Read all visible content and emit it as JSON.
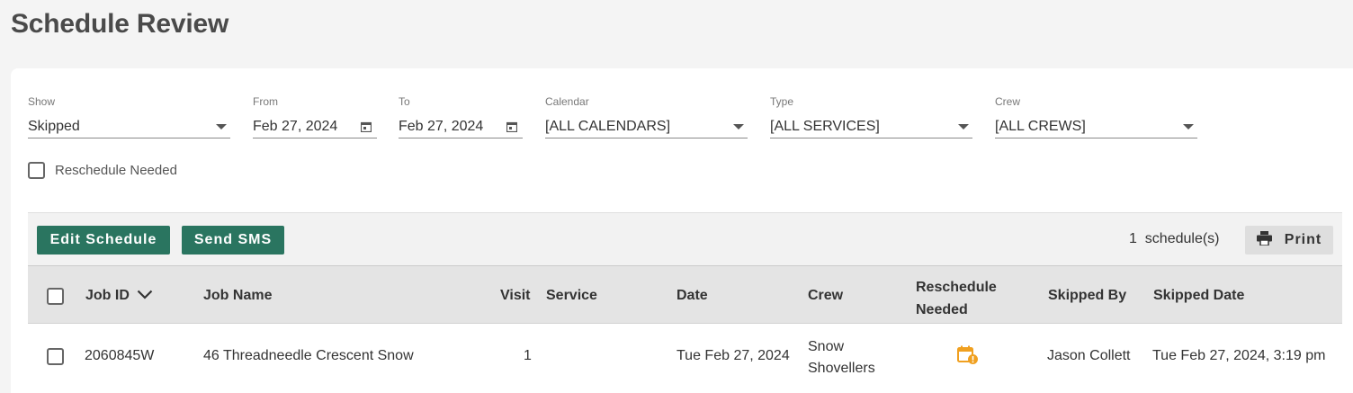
{
  "page": {
    "title": "Schedule Review"
  },
  "filters": {
    "show": {
      "label": "Show",
      "value": "Skipped"
    },
    "from": {
      "label": "From",
      "value": "Feb 27, 2024"
    },
    "to": {
      "label": "To",
      "value": "Feb 27, 2024"
    },
    "calendar": {
      "label": "Calendar",
      "value": "[ALL CALENDARS]"
    },
    "type": {
      "label": "Type",
      "value": "[ALL SERVICES]"
    },
    "crew": {
      "label": "Crew",
      "value": "[ALL CREWS]"
    },
    "reschedule_needed": {
      "label": "Reschedule Needed",
      "checked": false
    }
  },
  "toolbar": {
    "edit_schedule_label": "Edit Schedule",
    "send_sms_label": "Send SMS",
    "count_value": "1",
    "count_unit": "schedule(s)",
    "print_label": "Print",
    "accent_color": "#2a7560"
  },
  "table": {
    "columns": {
      "job_id": "Job ID",
      "job_name": "Job Name",
      "visit": "Visit",
      "service": "Service",
      "date": "Date",
      "crew": "Crew",
      "reschedule_needed_line1": "Reschedule",
      "reschedule_needed_line2": "Needed",
      "skipped_by": "Skipped By",
      "skipped_date": "Skipped Date"
    },
    "sort": {
      "column": "job_id",
      "icon": "chevron-down-icon"
    },
    "rows": [
      {
        "job_id": "2060845W",
        "job_name": "46 Threadneedle Crescent Snow",
        "visit": "1",
        "service": "",
        "date": "Tue Feb 27, 2024",
        "crew_line1": "Snow",
        "crew_line2": "Shovellers",
        "reschedule_icon": "calendar-alert-icon",
        "reschedule_icon_color": "#f0a020",
        "skipped_by": "Jason Collett",
        "skipped_date": "Tue Feb 27, 2024, 3:19 pm"
      }
    ]
  }
}
